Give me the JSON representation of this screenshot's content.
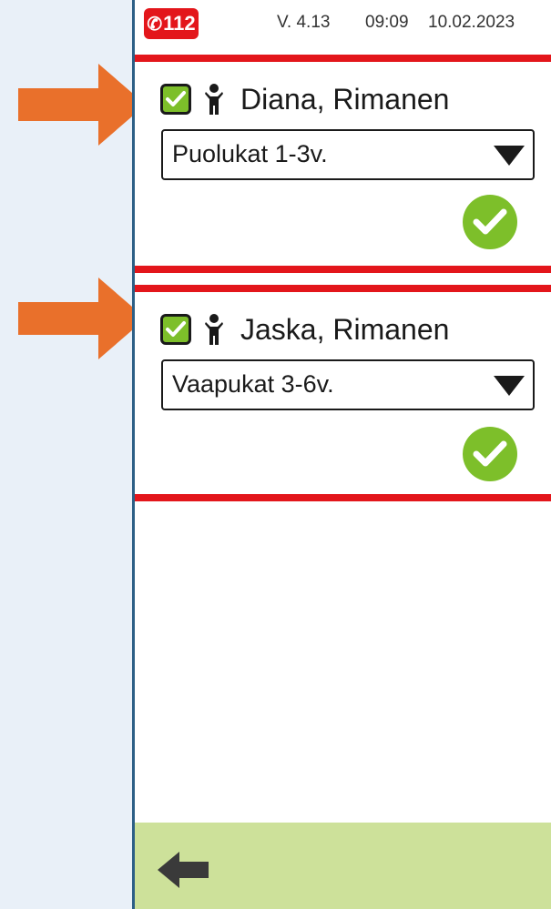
{
  "status_bar": {
    "emergency_number": "112",
    "version": "V. 4.13",
    "time": "09:09",
    "date": "10.02.2023"
  },
  "children": [
    {
      "name": "Diana, Rimanen",
      "checked": true,
      "group": "Puolukat 1-3v.",
      "confirmed": true
    },
    {
      "name": "Jaska, Rimanen",
      "checked": true,
      "group": "Vaapukat 3-6v.",
      "confirmed": true
    }
  ],
  "icons": {
    "emergency": "phone-icon",
    "child": "child-icon",
    "checkbox": "checkmark-icon",
    "dropdown": "triangle-down-icon",
    "confirm": "check-circle-icon",
    "back": "arrow-left-icon",
    "annotation": "arrow-right-icon"
  },
  "colors": {
    "accent_red": "#e3161b",
    "check_green": "#7dbf2a",
    "footer_green": "#cde19a",
    "annotation_orange": "#e9702b",
    "page_background": "#e9f0f8"
  }
}
